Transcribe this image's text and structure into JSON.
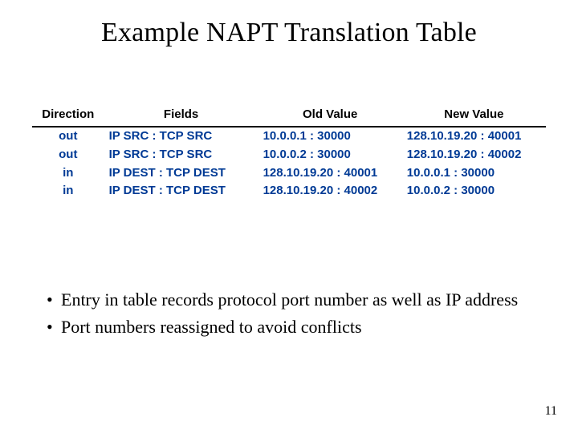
{
  "title": "Example NAPT Translation Table",
  "table": {
    "headers": {
      "direction": "Direction",
      "fields": "Fields",
      "old_value": "Old Value",
      "new_value": "New Value"
    },
    "rows": [
      {
        "direction": "out",
        "fields": "IP SRC : TCP SRC",
        "old_value": "10.0.0.1 : 30000",
        "new_value": "128.10.19.20 : 40001"
      },
      {
        "direction": "out",
        "fields": "IP SRC : TCP SRC",
        "old_value": "10.0.0.2 : 30000",
        "new_value": "128.10.19.20 : 40002"
      },
      {
        "direction": "in",
        "fields": "IP DEST : TCP DEST",
        "old_value": "128.10.19.20 : 40001",
        "new_value": "10.0.0.1 : 30000"
      },
      {
        "direction": "in",
        "fields": "IP DEST : TCP DEST",
        "old_value": "128.10.19.20 : 40002",
        "new_value": "10.0.0.2 : 30000"
      }
    ]
  },
  "bullets": [
    "Entry in table records protocol port number as well as IP address",
    "Port numbers reassigned to avoid conflicts"
  ],
  "page_number": "11"
}
